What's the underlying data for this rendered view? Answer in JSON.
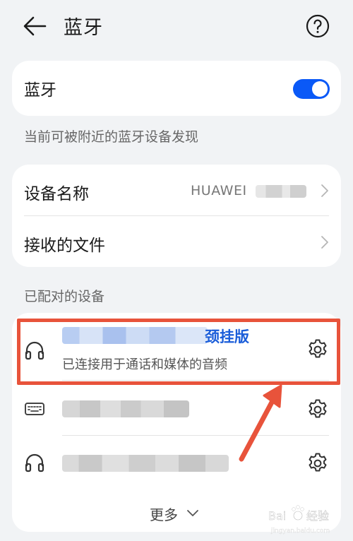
{
  "header": {
    "title": "蓝牙"
  },
  "bluetooth": {
    "label": "蓝牙",
    "enabled": true,
    "hint": "当前可被附近的蓝牙设备发现"
  },
  "info": {
    "device_name_label": "设备名称",
    "device_name_value": "HUAWEI",
    "received_files_label": "接收的文件"
  },
  "paired": {
    "section_title": "已配对的设备",
    "devices": [
      {
        "icon": "headphones-icon",
        "name_suffix": "颈挂版",
        "status": "已连接用于通话和媒体的音频"
      },
      {
        "icon": "keyboard-icon"
      },
      {
        "icon": "headphones-icon"
      }
    ],
    "more_label": "更多"
  },
  "watermark": {
    "brand": "Bai",
    "brand_cn": "经验",
    "url": "jingyan.baidu.com"
  },
  "colors": {
    "accent": "#0a59f7",
    "highlight": "#e8533b",
    "background": "#f1f3f5"
  }
}
